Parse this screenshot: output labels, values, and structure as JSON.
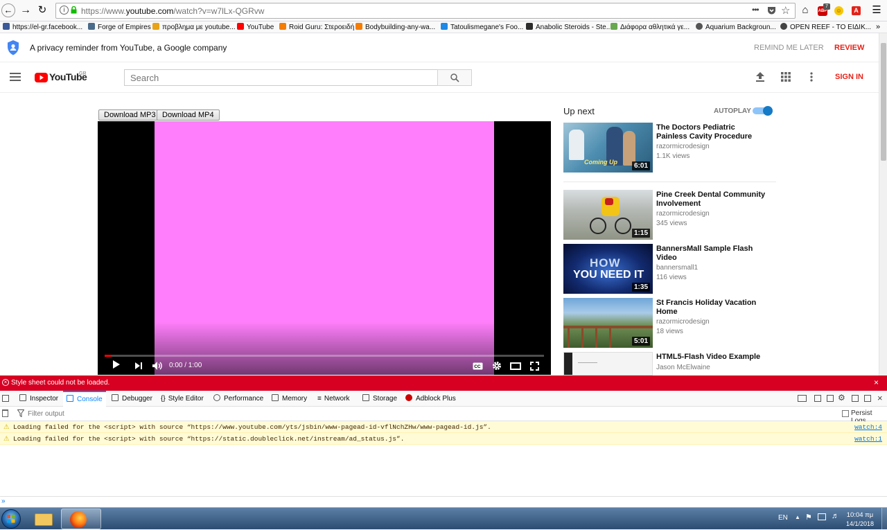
{
  "browser": {
    "url_prefix": "https://www.",
    "url_domain": "youtube.com",
    "url_rest": "/watch?v=w7lLx-QGRvw",
    "more_label": "•••",
    "addon_badge": "7",
    "bookmarks": [
      {
        "label": "https://el-gr.facebook...",
        "icon_color": "#3b5998"
      },
      {
        "label": "Forge of Empires",
        "icon_color": "#4a6b8a"
      },
      {
        "label": "προβλημα με youtube...",
        "icon_color": "#e8a317"
      },
      {
        "label": "YouTube",
        "icon_color": "#ff0000"
      },
      {
        "label": "Roid Guru: Στεροειδή",
        "icon_color": "#f57d00"
      },
      {
        "label": "Bodybuilding-any-wa...",
        "icon_color": "#f57d00"
      },
      {
        "label": "Tatoulismegane's Foo...",
        "icon_color": "#1e88e5"
      },
      {
        "label": "Anabolic Steroids - Ste...",
        "icon_color": "#2c2c2c"
      },
      {
        "label": "Διάφορα αθλητικά γε...",
        "icon_color": "#6aa84f"
      },
      {
        "label": "Aquarium Backgroun...",
        "icon_color": "#555555"
      },
      {
        "label": "OPEN REEF - ΤΟ ΕΙΔΙΚ...",
        "icon_color": "#444444"
      }
    ],
    "bookmarks_more": "»"
  },
  "privacy": {
    "text": "A privacy reminder from YouTube, a Google company",
    "remind_later": "REMIND ME LATER",
    "review": "REVIEW"
  },
  "yt": {
    "logo_text": "YouTube",
    "region": "GR",
    "search_placeholder": "Search",
    "sign_in": "SIGN IN",
    "accent": "#ff0000"
  },
  "video": {
    "download_mp3": "Download MP3",
    "download_mp4": "Download MP4",
    "time": "0:00 / 1:00",
    "frame_color": "#fe7efb",
    "progress": 0
  },
  "upnext": {
    "heading": "Up next",
    "autoplay": "AUTOPLAY",
    "autoplay_on": true,
    "items": [
      {
        "title": "The Doctors Pediatric Painless Cavity Procedure",
        "channel": "razormicrodesign",
        "views": "1.1K views",
        "duration": "6:01",
        "thumb_overlay": "Coming Up"
      },
      {
        "title": "Pine Creek Dental Community Involvement",
        "channel": "razormicrodesign",
        "views": "345 views",
        "duration": "1:15"
      },
      {
        "title": "BannersMall Sample Flash Video",
        "channel": "bannersmall1",
        "views": "116 views",
        "duration": "1:35",
        "thumb_overlay_1": "HOW",
        "thumb_overlay_2": "YOU NEED IT"
      },
      {
        "title": "St Francis Holiday Vacation Home",
        "channel": "razormicrodesign",
        "views": "18 views",
        "duration": "5:01"
      },
      {
        "title": "HTML5-Flash Video Example",
        "channel": "Jason McElwaine",
        "views": "",
        "duration": ""
      }
    ]
  },
  "devtools": {
    "error": "Style sheet could not be loaded.",
    "tabs": [
      "Inspector",
      "Console",
      "Debugger",
      "Style Editor",
      "Performance",
      "Memory",
      "Network",
      "Storage",
      "Adblock Plus"
    ],
    "active_tab": "Console",
    "filter_placeholder": "Filter output",
    "persist_logs": "Persist Logs",
    "messages": [
      {
        "text": "Loading failed for the <script> with source “https://www.youtube.com/yts/jsbin/www-pagead-id-vflNchZHw/www-pagead-id.js”.",
        "location": "watch:4"
      },
      {
        "text": "Loading failed for the <script> with source “https://static.doubleclick.net/instream/ad_status.js”.",
        "location": "watch:1"
      }
    ],
    "prompt": "»"
  },
  "taskbar": {
    "lang": "EN",
    "time": "10:04 πμ",
    "date": "14/1/2018"
  }
}
